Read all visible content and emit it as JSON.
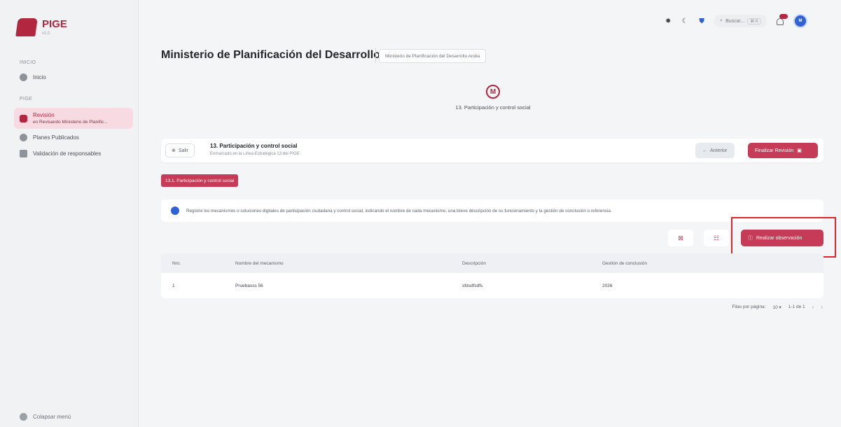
{
  "app": {
    "logo_text": "PIGE",
    "version": "v1.0"
  },
  "sidebar": {
    "section_inicio": "INICIO",
    "section_pige": "PIGE",
    "items": [
      {
        "label": "Inicio",
        "icon": "home-icon"
      },
      {
        "label": "Revisión",
        "sub": "en Revisando Ministerio de Planific...",
        "icon": "document-icon"
      },
      {
        "label": "Planes Publicados",
        "icon": "checklist-icon"
      },
      {
        "label": "Validación de responsables",
        "icon": "user-icon"
      }
    ],
    "collapse_label": "Colapsar menú"
  },
  "topbar": {
    "search_placeholder": "Buscar...",
    "shortcut": "⌘ K",
    "avatar_initials": "M"
  },
  "header": {
    "title": "Ministerio de Planificación del Desarrollo",
    "subtitle": "Ministerio de Planificación del Desarrollo Andia"
  },
  "step": {
    "letter": "M",
    "title": "13. Participación y control social"
  },
  "section_bar": {
    "exit_label": "Salir",
    "title": "13. Participación y control social",
    "subtitle": "Enmarcado en la Línea Estratégica 13 del PIGE",
    "prev_label": "Anterior",
    "finish_label": "Finalizar Revisión"
  },
  "tag": "13.1. Participación y control social",
  "info": "Registre los mecanismos o soluciones digitales de participación ciudadana y control social, indicando el nombre de cada mecanismo, una breve descripción de su funcionamiento y la gestión de conclusión o referencia.",
  "actions": {
    "observation_label": "Realizar observación"
  },
  "table": {
    "headers": [
      "Nro.",
      "Nombre del mecanismo",
      "Descripción",
      "Gestión de conclusión"
    ],
    "rows": [
      [
        "1",
        "Pruebasss 56",
        "sfdsdfsdfs",
        "2026"
      ]
    ]
  },
  "pagination": {
    "rows_label": "Filas por página:",
    "rows_value": "10",
    "range": "1-1 de 1"
  },
  "colors": {
    "accent": "#c63b58",
    "brand": "#b3263f",
    "info": "#2f62d6",
    "highlight": "#e3242b"
  }
}
